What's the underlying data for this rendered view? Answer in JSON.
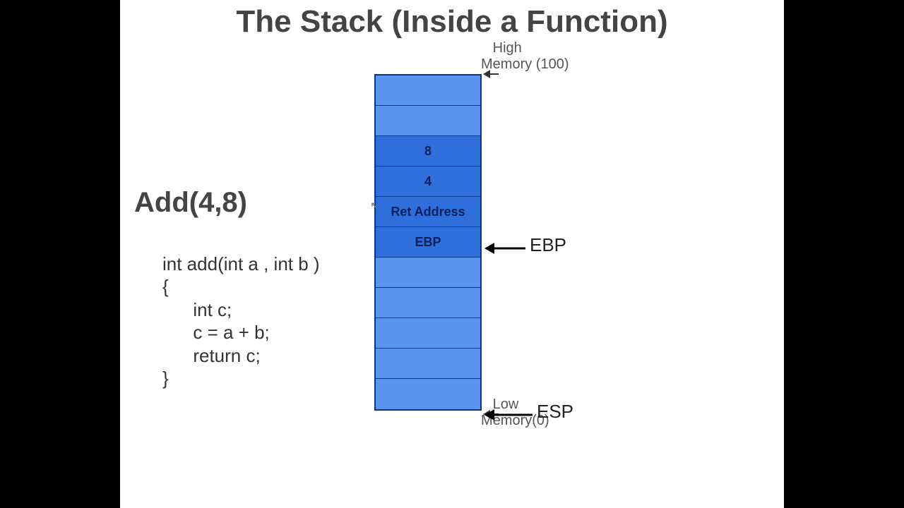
{
  "title": "The Stack (Inside a Function)",
  "call_header": "Add(4,8)",
  "code": {
    "l1": "int add(int a , int b )",
    "l2": "{",
    "l3": "      int c;",
    "l4": "      c = a + b;",
    "l5": "      return c;",
    "l6": "}"
  },
  "stack_cells": {
    "c0": "",
    "c1": "",
    "c2": "8",
    "c3": "4",
    "c4": "Ret Address",
    "c5": "EBP",
    "c6": "",
    "c7": "",
    "c8": "",
    "c9": "",
    "c10": ""
  },
  "labels": {
    "high_mem_l1": "High",
    "high_mem_l2": "Memory (100)",
    "low_mem_l1": "Low",
    "low_mem_l2": "Memory(0)",
    "ebp": "EBP",
    "esp": "ESP"
  }
}
